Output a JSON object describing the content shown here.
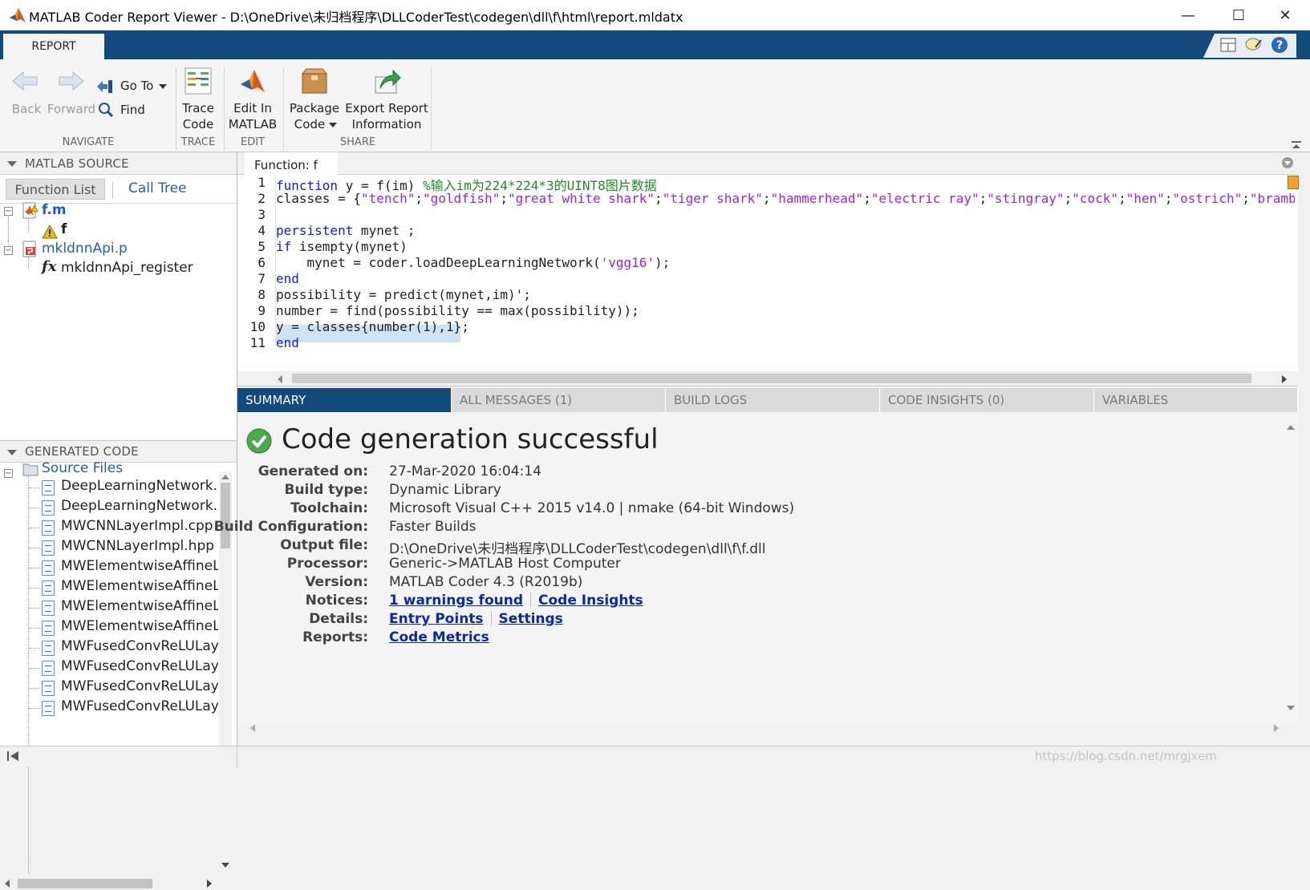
{
  "window": {
    "title": "MATLAB Coder Report Viewer - D:\\OneDrive\\未归档程序\\DLLCoderTest\\codegen\\dll\\f\\html\\report.mldatx",
    "minimize": "—",
    "maximize": "☐",
    "close": "✕"
  },
  "ribbon": {
    "tab": "REPORT",
    "back": "Back",
    "forward": "Forward",
    "goto": "Go To",
    "find": "Find",
    "trace": [
      "Trace",
      "Code"
    ],
    "edit": [
      "Edit In",
      "MATLAB"
    ],
    "package": [
      "Package",
      "Code"
    ],
    "export": [
      "Export Report",
      "Information"
    ],
    "sections": {
      "navigate": "NAVIGATE",
      "trace": "TRACE",
      "edit": "EDIT",
      "share": "SHARE"
    }
  },
  "left": {
    "source_header": "MATLAB SOURCE",
    "tabs": {
      "function_list": "Function List",
      "call_tree": "Call Tree"
    },
    "tree": [
      {
        "label": "f.m"
      },
      {
        "label": "f"
      },
      {
        "label": "mkldnnApi.p"
      },
      {
        "label": "mkldnnApi_register"
      }
    ],
    "generated_header": "GENERATED CODE",
    "source_files": "Source Files",
    "files": [
      "DeepLearningNetwork.cp",
      "DeepLearningNetwork.h",
      "MWCNNLayerImpl.cpp",
      "MWCNNLayerImpl.hpp",
      "MWElementwiseAffineLay",
      "MWElementwiseAffineLay",
      "MWElementwiseAffineLay",
      "MWElementwiseAffineLay",
      "MWFusedConvReLULayer",
      "MWFusedConvReLULayer",
      "MWFusedConvReLULayer",
      "MWFusedConvReLULayer"
    ]
  },
  "code": {
    "tab": "Function: f",
    "line_numbers": [
      "1",
      "2",
      "3",
      "4",
      "5",
      "6",
      "7",
      "8",
      "9",
      "10",
      "11"
    ],
    "l1_kw": "function",
    "l1_rest": " y = f(im) ",
    "l1_cmt": "%输入im为224*224*3的UINT8图片数据",
    "l2_pre": "classes = {",
    "l2_items": [
      "\"tench\"",
      "\"goldfish\"",
      "\"great white shark\"",
      "\"tiger shark\"",
      "\"hammerhead\"",
      "\"electric ray\"",
      "\"stingray\"",
      "\"cock\"",
      "\"hen\"",
      "\"ostrich\"",
      "\"bramb"
    ],
    "l4_kw": "persistent",
    "l4_rest": " mynet ;",
    "l5_kw": "if",
    "l5_rest": " isempty(mynet)",
    "l6_pre": "    mynet = coder.loadDeepLearningNetwork(",
    "l6_str": "'vgg16'",
    "l6_post": ");",
    "l7_kw": "end",
    "l8": "possibility = predict(mynet,im)';",
    "l9": "number = find(possibility == max(possibility));",
    "l10": "y = classes{number(1),1};",
    "l11_kw": "end"
  },
  "messages": {
    "tabs": [
      "SUMMARY",
      "ALL MESSAGES (1)",
      "BUILD LOGS",
      "CODE INSIGHTS (0)",
      "VARIABLES"
    ]
  },
  "summary": {
    "heading": "Code generation successful",
    "rows": [
      {
        "label": "Generated on:",
        "value": "27-Mar-2020 16:04:14"
      },
      {
        "label": "Build type:",
        "value": "Dynamic Library"
      },
      {
        "label": "Toolchain:",
        "value": "Microsoft Visual C++ 2015 v14.0 | nmake (64-bit Windows)"
      },
      {
        "label": "Build Configuration:",
        "value": "Faster Builds"
      },
      {
        "label": "Output file:",
        "value": "D:\\OneDrive\\未归档程序\\DLLCoderTest\\codegen\\dll\\f\\f.dll"
      },
      {
        "label": "Processor:",
        "value": "Generic->MATLAB Host Computer"
      },
      {
        "label": "Version:",
        "value": "MATLAB Coder 4.3 (R2019b)"
      },
      {
        "label": "Notices:",
        "links": [
          "1 warnings found",
          "Code Insights"
        ]
      },
      {
        "label": "Details:",
        "links": [
          "Entry Points",
          "Settings"
        ]
      },
      {
        "label": "Reports:",
        "links": [
          "Code Metrics"
        ]
      }
    ]
  },
  "watermark": "https://blog.csdn.net/mrgjxem"
}
